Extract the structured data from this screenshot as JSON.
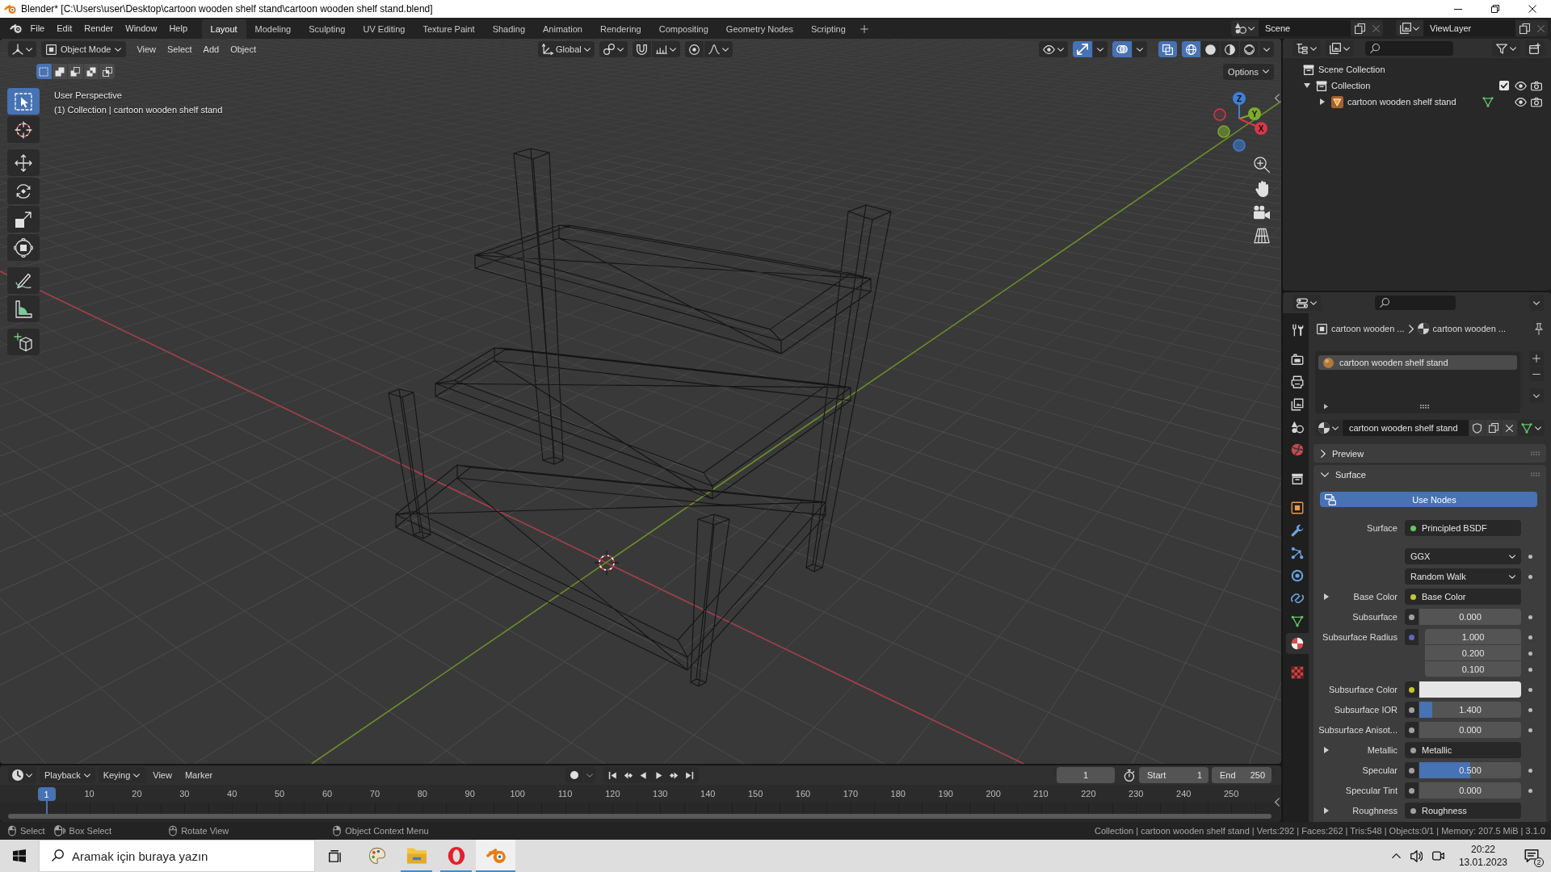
{
  "window": {
    "title": "Blender* [C:\\Users\\user\\Desktop\\cartoon wooden shelf stand\\cartoon wooden shelf stand.blend]"
  },
  "menu": [
    "File",
    "Edit",
    "Render",
    "Window",
    "Help"
  ],
  "workspaces": [
    {
      "label": "Layout",
      "selected": true
    },
    {
      "label": "Modeling",
      "selected": false
    },
    {
      "label": "Sculpting",
      "selected": false
    },
    {
      "label": "UV Editing",
      "selected": false
    },
    {
      "label": "Texture Paint",
      "selected": false
    },
    {
      "label": "Shading",
      "selected": false
    },
    {
      "label": "Animation",
      "selected": false
    },
    {
      "label": "Rendering",
      "selected": false
    },
    {
      "label": "Compositing",
      "selected": false
    },
    {
      "label": "Geometry Nodes",
      "selected": false
    },
    {
      "label": "Scripting",
      "selected": false
    }
  ],
  "scene": "Scene",
  "view_layer": "ViewLayer",
  "viewport": {
    "mode": "Object Mode",
    "menus": [
      "View",
      "Select",
      "Add",
      "Object"
    ],
    "orientation": "Global",
    "toggles": [
      {
        "kind": "gizmos",
        "on": true
      },
      {
        "kind": "overlays",
        "on": true
      },
      {
        "kind": "xray",
        "on": true
      }
    ],
    "shading": [
      {
        "kind": "wireframe",
        "selected": true
      },
      {
        "kind": "solid",
        "selected": false
      },
      {
        "kind": "material",
        "selected": false
      },
      {
        "kind": "rendered",
        "selected": false
      }
    ],
    "select_modes": [
      {
        "kind": "set",
        "selected": true
      },
      {
        "kind": "extend",
        "selected": false
      },
      {
        "kind": "subtract",
        "selected": false
      },
      {
        "kind": "difference",
        "selected": false
      },
      {
        "kind": "intersect",
        "selected": false
      }
    ],
    "options": "Options",
    "info": [
      "User Perspective",
      "(1) Collection | cartoon wooden shelf stand"
    ],
    "tool_groups": [
      {
        "tools": [
          {
            "kind": "select_box",
            "selected": true
          },
          {
            "kind": "cursor",
            "selected": false
          }
        ]
      },
      {
        "tools": [
          {
            "kind": "move",
            "selected": false
          },
          {
            "kind": "rotate",
            "selected": false
          },
          {
            "kind": "scale",
            "selected": false
          },
          {
            "kind": "transform",
            "selected": false
          }
        ]
      },
      {
        "tools": [
          {
            "kind": "annotate",
            "selected": false
          },
          {
            "kind": "measure",
            "selected": false
          }
        ]
      },
      {
        "tools": [
          {
            "kind": "add_cube",
            "selected": false
          }
        ]
      }
    ],
    "gizmo": [
      {
        "kind": "z",
        "label": "Z",
        "color": "#3d80d6"
      },
      {
        "kind": "y",
        "label": "Y",
        "color": "#7eab2e"
      },
      {
        "kind": "x",
        "label": "X",
        "color": "#d2394c"
      }
    ]
  },
  "outliner": {
    "tree": [
      {
        "kind": "scene_collection",
        "label": "Scene Collection",
        "children": [
          {
            "kind": "collection",
            "label": "Collection",
            "expanded": true,
            "checked": true,
            "visible": true,
            "renderable": true,
            "children": [
              {
                "kind": "mesh_object",
                "label": "cartoon wooden shelf stand",
                "expanded": false,
                "visible": true,
                "renderable": true
              }
            ]
          }
        ]
      }
    ]
  },
  "properties": {
    "tab_groups": [
      {
        "tabs": [
          {
            "kind": "tool",
            "selected": false
          }
        ]
      },
      {
        "tabs": [
          {
            "kind": "render",
            "selected": false
          },
          {
            "kind": "output",
            "selected": false
          },
          {
            "kind": "view_layer",
            "selected": false
          },
          {
            "kind": "scene",
            "selected": false
          },
          {
            "kind": "world",
            "selected": false
          }
        ]
      },
      {
        "tabs": [
          {
            "kind": "collection",
            "selected": false
          }
        ]
      },
      {
        "tabs": [
          {
            "kind": "object",
            "selected": false
          },
          {
            "kind": "modifiers",
            "selected": false
          },
          {
            "kind": "particles",
            "selected": false
          },
          {
            "kind": "physics",
            "selected": false
          },
          {
            "kind": "constraints",
            "selected": false
          },
          {
            "kind": "data",
            "selected": false
          },
          {
            "kind": "material",
            "selected": true
          }
        ]
      },
      {
        "tabs": [
          {
            "kind": "texture",
            "selected": false
          }
        ]
      }
    ],
    "breadcrumb": [
      {
        "kind": "object",
        "label": "cartoon wooden ..."
      },
      {
        "kind": "material",
        "label": "cartoon wooden ..."
      }
    ],
    "slots": [
      {
        "label": "cartoon wooden shelf stand",
        "selected": true
      }
    ],
    "material": "cartoon wooden shelf stand",
    "panels": [
      {
        "label": "Preview",
        "expanded": false
      },
      {
        "label": "Surface",
        "expanded": true,
        "use_nodes": {
          "label": "Use Nodes",
          "on": true
        },
        "rows": [
          {
            "kind": "link",
            "label": "Surface",
            "value": "Principled BSDF",
            "color": "#63c763"
          },
          {
            "kind": "dropdown",
            "value": "GGX"
          },
          {
            "kind": "dropdown",
            "value": "Random Walk"
          },
          {
            "kind": "link",
            "label": "Base Color",
            "value": "Base Color",
            "color": "#c7c729",
            "expanded": false
          },
          {
            "kind": "number",
            "label": "Subsurface",
            "value": "0.000",
            "color": "#a1a1a1"
          },
          {
            "kind": "vector",
            "label": "Subsurface Radius",
            "values": [
              "1.000",
              "0.200",
              "0.100"
            ],
            "color": "#6363c7"
          },
          {
            "kind": "color",
            "label": "Subsurface Color",
            "color": "#c7c729",
            "swatch": {
              "color": "#e6e6e6"
            }
          },
          {
            "kind": "number",
            "label": "Subsurface IOR",
            "value": "1.400",
            "color": "#a1a1a1",
            "level": 0.13
          },
          {
            "kind": "number",
            "label": "Subsurface Anisot...",
            "value": "0.000",
            "color": "#a1a1a1"
          },
          {
            "kind": "link",
            "label": "Metallic",
            "value": "Metallic",
            "color": "#a1a1a1",
            "expanded": false
          },
          {
            "kind": "number",
            "label": "Specular",
            "value": "0.500",
            "color": "#a1a1a1",
            "level": 0.5
          },
          {
            "kind": "number",
            "label": "Specular Tint",
            "value": "0.000",
            "color": "#a1a1a1"
          },
          {
            "kind": "link",
            "label": "Roughness",
            "value": "Roughness",
            "color": "#a1a1a1",
            "expanded": false
          }
        ]
      }
    ]
  },
  "timeline": {
    "menus": [
      {
        "label": "Playback",
        "dropdown": true
      },
      {
        "label": "Keying",
        "dropdown": true
      },
      {
        "label": "View",
        "dropdown": false
      },
      {
        "label": "Marker",
        "dropdown": false
      }
    ],
    "auto_key": false,
    "current_frame": "1",
    "start": {
      "label": "Start",
      "value": "1"
    },
    "end": {
      "label": "End",
      "value": "250"
    },
    "playhead": "1",
    "ticks": [
      "10",
      "20",
      "30",
      "40",
      "50",
      "60",
      "70",
      "80",
      "90",
      "100",
      "110",
      "120",
      "130",
      "140",
      "150",
      "160",
      "170",
      "180",
      "190",
      "200",
      "210",
      "220",
      "230",
      "240",
      "250"
    ]
  },
  "status_bar": {
    "hints": [
      {
        "kind": "left",
        "label": "Select"
      },
      {
        "kind": "drag",
        "label": "Box Select"
      },
      {
        "kind": "middle",
        "label": "Rotate View"
      },
      {
        "kind": "right",
        "label": "Object Context Menu"
      }
    ],
    "stats": "Collection | cartoon wooden shelf stand | Verts:292 | Faces:262 | Tris:548 | Objects:0/1 | Memory: 207.5 MiB | 3.1.0"
  },
  "taskbar": {
    "search": {
      "placeholder": "Aramak için buraya yazın"
    },
    "apps": [
      {
        "kind": "paint",
        "running": false,
        "selected": false
      },
      {
        "kind": "explorer",
        "running": true,
        "selected": false
      },
      {
        "kind": "opera",
        "running": true,
        "selected": false
      },
      {
        "kind": "blender",
        "running": true,
        "selected": true
      }
    ],
    "time": "20:22",
    "date": "13.01.2023",
    "notifications": "2"
  }
}
